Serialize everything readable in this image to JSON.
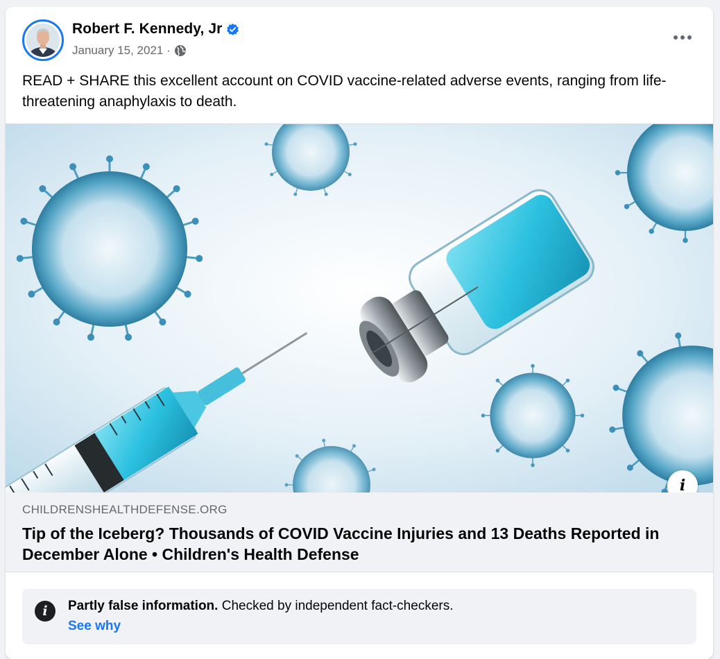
{
  "post": {
    "author": "Robert F. Kennedy, Jr",
    "date": "January 15, 2021",
    "separator": "·",
    "text": "READ + SHARE this excellent account on COVID vaccine-related adverse events, ranging from life-threatening anaphylaxis to death."
  },
  "link": {
    "domain": "CHILDRENSHEALTHDEFENSE.ORG",
    "title": "Tip of the Iceberg? Thousands of COVID Vaccine Injuries and 13 Deaths Reported in December Alone • Children's Health Defense"
  },
  "fact_check": {
    "label": "Partly false information.",
    "detail": "Checked by independent fact-checkers.",
    "link": "See why"
  },
  "icons": {
    "verified": "verified-badge-icon",
    "audience": "globe-icon",
    "menu": "more-options-icon",
    "image_info": "info-icon",
    "fact_check": "info-circle-icon"
  },
  "colors": {
    "accent": "#1877f2",
    "muted": "#65676b",
    "panel": "#f0f2f5"
  }
}
